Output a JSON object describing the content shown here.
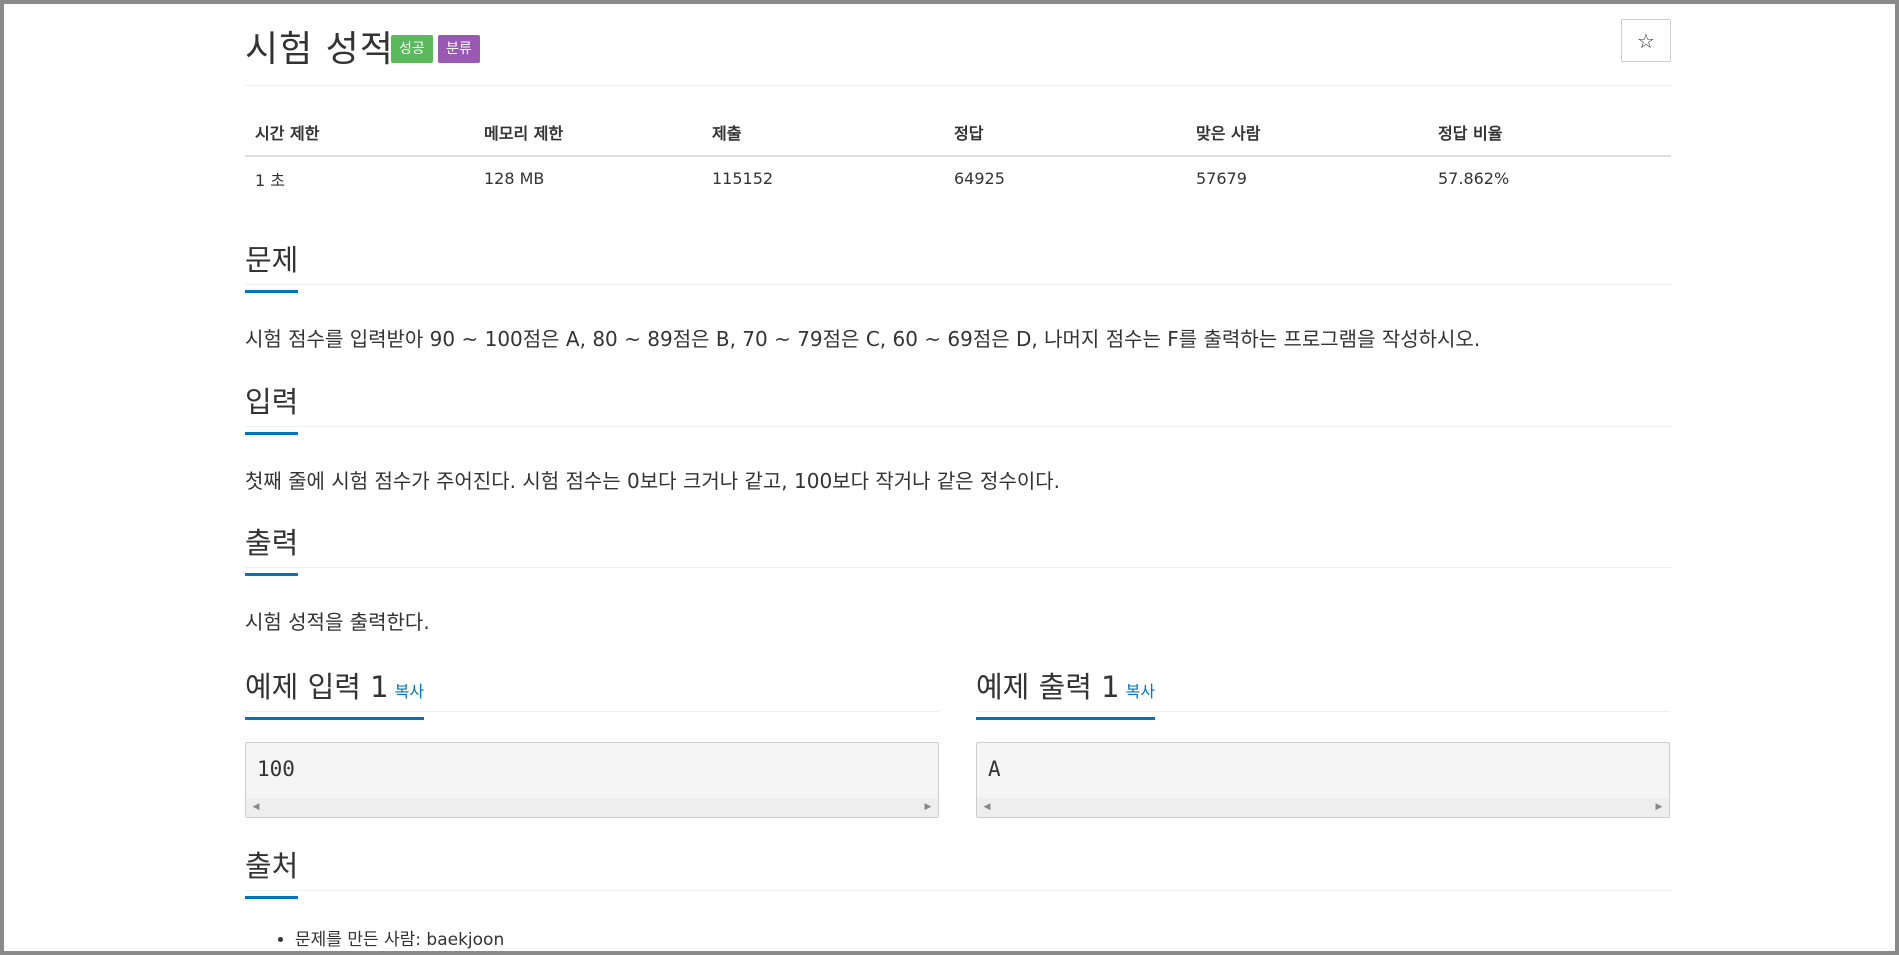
{
  "problem": {
    "title": "시험 성적",
    "labels": {
      "success": "성공",
      "category": "분류"
    },
    "star_icon": "☆"
  },
  "info_table": {
    "headers": [
      "시간 제한",
      "메모리 제한",
      "제출",
      "정답",
      "맞은 사람",
      "정답 비율"
    ],
    "values": [
      "1 초",
      "128 MB",
      "115152",
      "64925",
      "57679",
      "57.862%"
    ]
  },
  "sections": {
    "description": {
      "title": "문제",
      "text": "시험 점수를 입력받아 90 ~ 100점은 A, 80 ~ 89점은 B, 70 ~ 79점은 C, 60 ~ 69점은 D, 나머지 점수는 F를 출력하는 프로그램을 작성하시오."
    },
    "input": {
      "title": "입력",
      "text": "첫째 줄에 시험 점수가 주어진다. 시험 점수는 0보다 크거나 같고, 100보다 작거나 같은 정수이다."
    },
    "output": {
      "title": "출력",
      "text": "시험 성적을 출력한다."
    },
    "source": {
      "title": "출처",
      "items": [
        "문제를 만든 사람: baekjoon"
      ]
    }
  },
  "samples": {
    "input": {
      "title": "예제 입력 1",
      "copy_label": "복사",
      "content": "100"
    },
    "output": {
      "title": "예제 출력 1",
      "copy_label": "복사",
      "content": "A"
    }
  },
  "colors": {
    "accent": "#0076c0",
    "success": "#5cb85c",
    "category": "#9b59b6"
  }
}
